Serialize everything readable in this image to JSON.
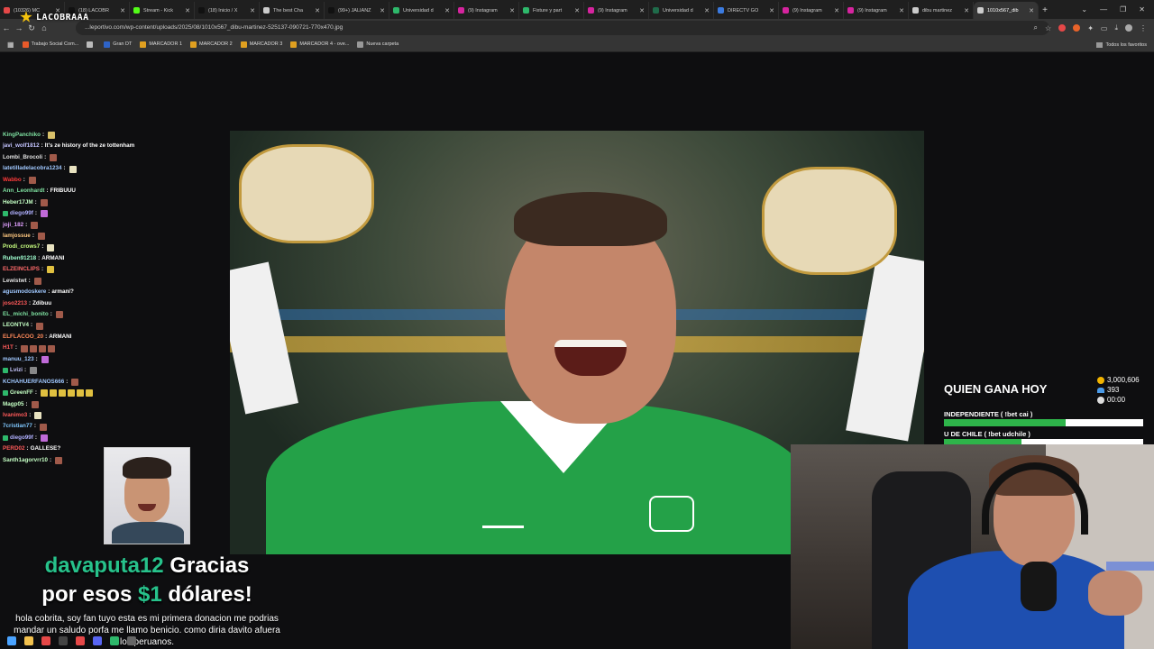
{
  "browser": {
    "tabs": [
      {
        "title": "(10326) MC",
        "color": "#e54848"
      },
      {
        "title": "(18) LACOBR",
        "color": "#111111"
      },
      {
        "title": "Stream - Kick",
        "color": "#53fc18"
      },
      {
        "title": "(18) Inicio / X",
        "color": "#111111"
      },
      {
        "title": "The best Cha",
        "color": "#cccccc"
      },
      {
        "title": "(99+) JALIANZ",
        "color": "#111111"
      },
      {
        "title": "Universidad d",
        "color": "#2eb86b"
      },
      {
        "title": "(9) Instagram",
        "color": "#d6249f"
      },
      {
        "title": "Fixture y part",
        "color": "#2eb86b"
      },
      {
        "title": "(9) Instagram",
        "color": "#d6249f"
      },
      {
        "title": "Universidad d",
        "color": "#1f6b4a"
      },
      {
        "title": "DIRECTV GO",
        "color": "#3b7be0"
      },
      {
        "title": "(9) Instagram",
        "color": "#d6249f"
      },
      {
        "title": "(9) Instagram",
        "color": "#d6249f"
      },
      {
        "title": "dibu martinez",
        "color": "#cccccc"
      },
      {
        "title": "1010x567_dib",
        "color": "#cccccc",
        "active": true
      }
    ],
    "url": "...leportivo.com/wp-content/uploads/2025/08/1010x567_dibu-martinez-525137-090721-770x470.jpg",
    "bookmarks": [
      {
        "label": "Trabajo Social Com...",
        "color": "#e85a2a"
      },
      {
        "label": "",
        "color": "#bbbbbb"
      },
      {
        "label": "Gran DT",
        "color": "#2e63c7"
      },
      {
        "label": "MARCADOR 1",
        "color": "#e0a020"
      },
      {
        "label": "MARCADOR 2",
        "color": "#e0a020"
      },
      {
        "label": "MARCADOR 3",
        "color": "#e0a020"
      },
      {
        "label": "MARCADOR 4 - ove...",
        "color": "#e0a020"
      },
      {
        "label": "Nueva carpeta",
        "color": "#999999"
      }
    ],
    "all_bookmarks": "Todos los favoritos"
  },
  "stream": {
    "channel_logo": "LACOBRAAA"
  },
  "chat": [
    {
      "user": "KingPanchiko",
      "color": "#7ee0a0",
      "msg": "",
      "emotes": [
        "#d8c06a"
      ]
    },
    {
      "user": "javi_wolf1812",
      "color": "#c4c4ff",
      "msg": "It's ze history of the ze tottenham",
      "emotes": []
    },
    {
      "user": "Lombi_Brocoli",
      "color": "#e0e0e0",
      "msg": "",
      "emotes": [
        "#a05a4a"
      ]
    },
    {
      "user": "latetilladelacobra1234",
      "color": "#a0c8ff",
      "msg": "",
      "emotes": [
        "#e8e2c0"
      ]
    },
    {
      "user": "Wabbo",
      "color": "#ff3a3a",
      "msg": "",
      "emotes": [
        "#a05a4a"
      ]
    },
    {
      "user": "Ann_Leonhardt",
      "color": "#7ee0a0",
      "msg": "FRIBUUU",
      "emotes": []
    },
    {
      "user": "Heber17JM",
      "color": "#c4ffc4",
      "msg": "",
      "emotes": [
        "#a05a4a"
      ]
    },
    {
      "user": "diego99f",
      "color": "#b0b0ff",
      "msg": "",
      "emotes": [
        "#c06ad8"
      ],
      "badge": true
    },
    {
      "user": "joji_182",
      "color": "#e0a0ff",
      "msg": "",
      "emotes": [
        "#a05a4a"
      ]
    },
    {
      "user": "lamjossue",
      "color": "#ffc880",
      "msg": "",
      "emotes": [
        "#a05a4a"
      ]
    },
    {
      "user": "Prodi_crows7",
      "color": "#c8ff80",
      "msg": "",
      "emotes": [
        "#e8e2c0"
      ]
    },
    {
      "user": "Ruben91218",
      "color": "#a0ffd0",
      "msg": "ARMANI",
      "emotes": []
    },
    {
      "user": "ELZEINCLIPS",
      "color": "#ff6a6a",
      "msg": "",
      "emotes": [
        "#e0c040"
      ]
    },
    {
      "user": "Lewistwt",
      "color": "#e0e0e0",
      "msg": "",
      "emotes": [
        "#a05a4a"
      ]
    },
    {
      "user": "agusmodoskere",
      "color": "#a0c8ff",
      "msg": "armani?",
      "emotes": []
    },
    {
      "user": "joso2213",
      "color": "#ff5a5a",
      "msg": "Zdibuu",
      "emotes": []
    },
    {
      "user": "EL_michi_bonito",
      "color": "#7ee0a0",
      "msg": "",
      "emotes": [
        "#a05a4a"
      ]
    },
    {
      "user": "LEONTV4",
      "color": "#c4ffc4",
      "msg": "",
      "emotes": [
        "#a05a4a"
      ]
    },
    {
      "user": "ELFLACOO_20",
      "color": "#ff8a5a",
      "msg": "ARMANI",
      "emotes": []
    },
    {
      "user": "H1T",
      "color": "#ff5a5a",
      "msg": "",
      "emotes": [
        "#a05a4a",
        "#a05a4a",
        "#a05a4a",
        "#a05a4a"
      ]
    },
    {
      "user": "manuu_123",
      "color": "#a0c8ff",
      "msg": "",
      "emotes": [
        "#c06ad8"
      ]
    },
    {
      "user": "Lvizi",
      "color": "#c8c8ff",
      "msg": "",
      "emotes": [
        "#888888"
      ],
      "badge": true
    },
    {
      "user": "KCHAHUERFANOS666",
      "color": "#a0c8ff",
      "msg": "",
      "emotes": [
        "#a05a4a"
      ]
    },
    {
      "user": "GreenFF",
      "color": "#c4ffc4",
      "msg": "",
      "emotes": [
        "#e0c040",
        "#e0c040",
        "#e0c040",
        "#e0c040",
        "#e0c040",
        "#e0c040"
      ],
      "badge": true
    },
    {
      "user": "Magp05",
      "color": "#c4ffc4",
      "msg": "",
      "emotes": [
        "#a05a4a"
      ]
    },
    {
      "user": "Ivanimo3",
      "color": "#ff5a5a",
      "msg": "",
      "emotes": [
        "#e8e2c0"
      ]
    },
    {
      "user": "7cristian77",
      "color": "#80c8ff",
      "msg": "",
      "emotes": [
        "#a05a4a"
      ]
    },
    {
      "user": "diego99f",
      "color": "#b0b0ff",
      "msg": "",
      "emotes": [
        "#c06ad8"
      ],
      "badge": true
    },
    {
      "user": "PERD02",
      "color": "#ff5a5a",
      "msg": "GALLESE?",
      "emotes": []
    },
    {
      "user": "Santh1agorvrr10",
      "color": "#c4ffc4",
      "msg": "",
      "emotes": [
        "#a05a4a"
      ]
    }
  ],
  "donation": {
    "donor": "davaputa12",
    "title_rest_1": " Gracias",
    "title_line2_a": "por esos ",
    "amount": "$1",
    "title_line2_b": " dólares!",
    "message": "hola cobrita, soy fan tuyo esta es mi primera donacion me podrias mandar un saludo porfa me llamo benicio. como diria davito afuera los peruanos."
  },
  "prediction": {
    "question": "QUIEN GANA HOY",
    "coins": "3,000,606",
    "users": "393",
    "time": "00:00",
    "options": [
      {
        "label": "INDEPENDIENTE ( !bet cai )",
        "fraction": 0.61
      },
      {
        "label": "U DE CHILE ( !bet udchile )",
        "fraction": 0.39
      }
    ]
  },
  "taskbar": {
    "icons": [
      {
        "name": "windows-icon",
        "color": "#4aa3ff"
      },
      {
        "name": "folder-icon",
        "color": "#f2c14e"
      },
      {
        "name": "chrome-icon",
        "color": "#e54848"
      },
      {
        "name": "obs-icon",
        "color": "#444444"
      },
      {
        "name": "chrome-profile-icon",
        "color": "#e54848"
      },
      {
        "name": "app-icon",
        "color": "#5865f2"
      },
      {
        "name": "app-icon-2",
        "color": "#2eb86b"
      },
      {
        "name": "app-icon-3",
        "color": "#666666"
      }
    ]
  }
}
